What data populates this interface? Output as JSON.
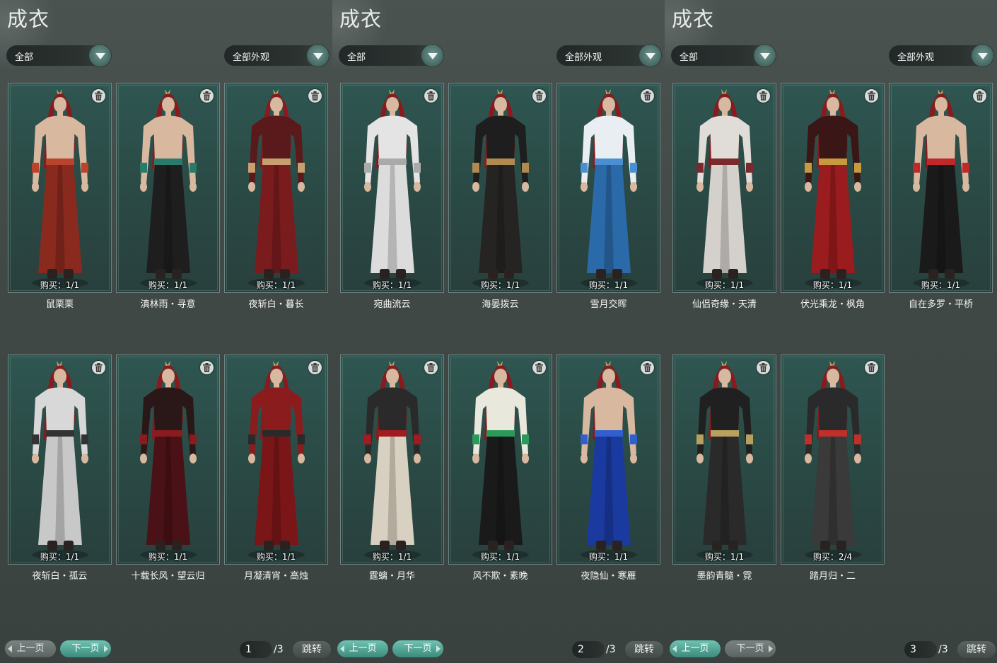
{
  "panels": [
    {
      "title": "成衣",
      "filter1": "全部",
      "filter2": "全部外观",
      "items": [
        {
          "buy": "购买：1/1",
          "name": "鼠栗栗",
          "top": "#2e2a28",
          "bottom": "#8a2a1e",
          "accent": "#b8442c",
          "bare": true
        },
        {
          "buy": "购买：1/1",
          "name": "滇林雨・寻意",
          "top": "#2e2a28",
          "bottom": "#1e1e1e",
          "accent": "#2a7a6a",
          "bare": true
        },
        {
          "buy": "购买：1/1",
          "name": "夜斩白・暮长",
          "top": "#5a1a1c",
          "bottom": "#7a1c1e",
          "accent": "#c8a070",
          "bare": false
        },
        {
          "buy": "购买：1/1",
          "name": "夜斩白・孤云",
          "top": "#d8d8d8",
          "bottom": "#c8c8c8",
          "accent": "#333333",
          "bare": false
        },
        {
          "buy": "购买：1/1",
          "name": "十载长风・望云归",
          "top": "#2a1818",
          "bottom": "#4a1216",
          "accent": "#8a1c20",
          "bare": false
        },
        {
          "buy": "购买：1/1",
          "name": "月凝清宵・高烛",
          "top": "#8a1c1e",
          "bottom": "#7a1618",
          "accent": "#2a2a2a",
          "bare": false
        }
      ],
      "page_current": "1",
      "page_total": "/3",
      "prev": "上一页",
      "next": "下一页",
      "jump": "跳转",
      "prev_on": false,
      "next_on": true
    },
    {
      "title": "成衣",
      "filter1": "全部",
      "filter2": "全部外观",
      "items": [
        {
          "buy": "购买：1/1",
          "name": "宛曲流云",
          "top": "#e4e4e4",
          "bottom": "#dcdcdc",
          "accent": "#aaaaaa",
          "bare": false
        },
        {
          "buy": "购买：1/1",
          "name": "海晏拨云",
          "top": "#1e1e1e",
          "bottom": "#262422",
          "accent": "#b08a50",
          "bare": false
        },
        {
          "buy": "购买：1/1",
          "name": "雪月交晖",
          "top": "#e8eef2",
          "bottom": "#2a6aa8",
          "accent": "#4a90d0",
          "bare": false
        },
        {
          "buy": "购买：1/1",
          "name": "霆螭・月华",
          "top": "#2a2a2a",
          "bottom": "#d8d0c0",
          "accent": "#a01c20",
          "bare": false
        },
        {
          "buy": "购买：1/1",
          "name": "风不欺・素晚",
          "top": "#e8e8dc",
          "bottom": "#1a1a1a",
          "accent": "#2a9a5a",
          "bare": false
        },
        {
          "buy": "购买：1/1",
          "name": "夜隐仙・寒雁",
          "top": "#1c2a6a",
          "bottom": "#1a3aa0",
          "accent": "#3060d0",
          "bare": true
        }
      ],
      "page_current": "2",
      "page_total": "/3",
      "prev": "上一页",
      "next": "下一页",
      "jump": "跳转",
      "prev_on": true,
      "next_on": true
    },
    {
      "title": "成衣",
      "filter1": "全部",
      "filter2": "全部外观",
      "items": [
        {
          "buy": "购买：1/1",
          "name": "仙侣奇缘・天清",
          "top": "#e0dcd8",
          "bottom": "#d4d0cc",
          "accent": "#7a2a2c",
          "bare": false
        },
        {
          "buy": "购买：1/1",
          "name": "伏光乘龙・枫角",
          "top": "#3a1616",
          "bottom": "#9a1c1e",
          "accent": "#c89a40",
          "bare": false
        },
        {
          "buy": "购买：1/1",
          "name": "自在多罗・平桥",
          "top": "#1e1e1e",
          "bottom": "#1a1a1a",
          "accent": "#c0282a",
          "bare": true
        },
        {
          "buy": "购买：1/1",
          "name": "墨韵青髓・霓",
          "top": "#202020",
          "bottom": "#2a2a2a",
          "accent": "#b8a060",
          "bare": false
        },
        {
          "buy": "购买：2/4",
          "name": "踏月归・二",
          "top": "#2a2a2a",
          "bottom": "#3a3a3a",
          "accent": "#c03028",
          "bare": false
        }
      ],
      "page_current": "3",
      "page_total": "/3",
      "prev": "上一页",
      "next": "下一页",
      "jump": "跳转",
      "prev_on": true,
      "next_on": false
    }
  ]
}
